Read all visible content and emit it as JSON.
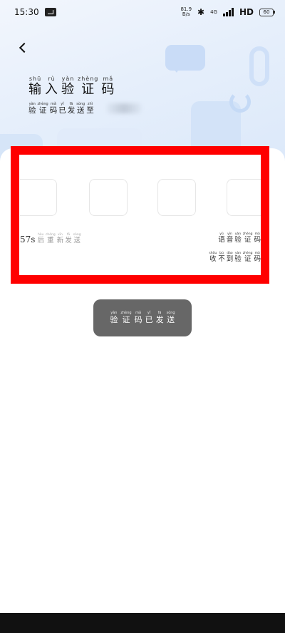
{
  "status_bar": {
    "time": "15:30",
    "net_speed_value": "81.9",
    "net_speed_unit": "B/s",
    "network_type": "4G",
    "hd_label": "HD",
    "battery": "60"
  },
  "header": {
    "title": [
      {
        "char": "输",
        "pinyin": "shū"
      },
      {
        "char": "入",
        "pinyin": "rù"
      },
      {
        "char": "验",
        "pinyin": "yàn"
      },
      {
        "char": "证",
        "pinyin": "zhèng"
      },
      {
        "char": "码",
        "pinyin": "mǎ"
      }
    ],
    "subtitle": [
      {
        "char": "验",
        "pinyin": "yàn"
      },
      {
        "char": "证",
        "pinyin": "zhèng"
      },
      {
        "char": "码",
        "pinyin": "mǎ"
      },
      {
        "char": "已",
        "pinyin": "yǐ"
      },
      {
        "char": "发",
        "pinyin": "fā"
      },
      {
        "char": "送",
        "pinyin": "sòng"
      },
      {
        "char": "至",
        "pinyin": "zhì"
      }
    ]
  },
  "code_input": {
    "countdown": "57s",
    "resend": [
      {
        "char": "后",
        "pinyin": "hòu"
      },
      {
        "char": "重",
        "pinyin": "chóng"
      },
      {
        "char": "新",
        "pinyin": "xīn"
      },
      {
        "char": "发",
        "pinyin": "fā"
      },
      {
        "char": "送",
        "pinyin": "sòng"
      }
    ],
    "voice_code": [
      {
        "char": "语",
        "pinyin": "yǔ"
      },
      {
        "char": "音",
        "pinyin": "yīn"
      },
      {
        "char": "验",
        "pinyin": "yàn"
      },
      {
        "char": "证",
        "pinyin": "zhèng"
      },
      {
        "char": "码",
        "pinyin": "mǎ"
      }
    ],
    "not_received": [
      {
        "char": "收",
        "pinyin": "shōu"
      },
      {
        "char": "不",
        "pinyin": "bú"
      },
      {
        "char": "到",
        "pinyin": "dào"
      },
      {
        "char": "验",
        "pinyin": "yàn"
      },
      {
        "char": "证",
        "pinyin": "zhèng"
      },
      {
        "char": "码",
        "pinyin": "mǎ"
      }
    ]
  },
  "toast": [
    {
      "char": "验",
      "pinyin": "yàn"
    },
    {
      "char": "证",
      "pinyin": "zhèng"
    },
    {
      "char": "码",
      "pinyin": "mǎ"
    },
    {
      "char": "已",
      "pinyin": "yǐ"
    },
    {
      "char": "发",
      "pinyin": "fā"
    },
    {
      "char": "送",
      "pinyin": "sòng"
    }
  ],
  "colors": {
    "highlight": "#ff0000",
    "toast_bg": "#676767",
    "hero_bg": "#e6effb"
  }
}
